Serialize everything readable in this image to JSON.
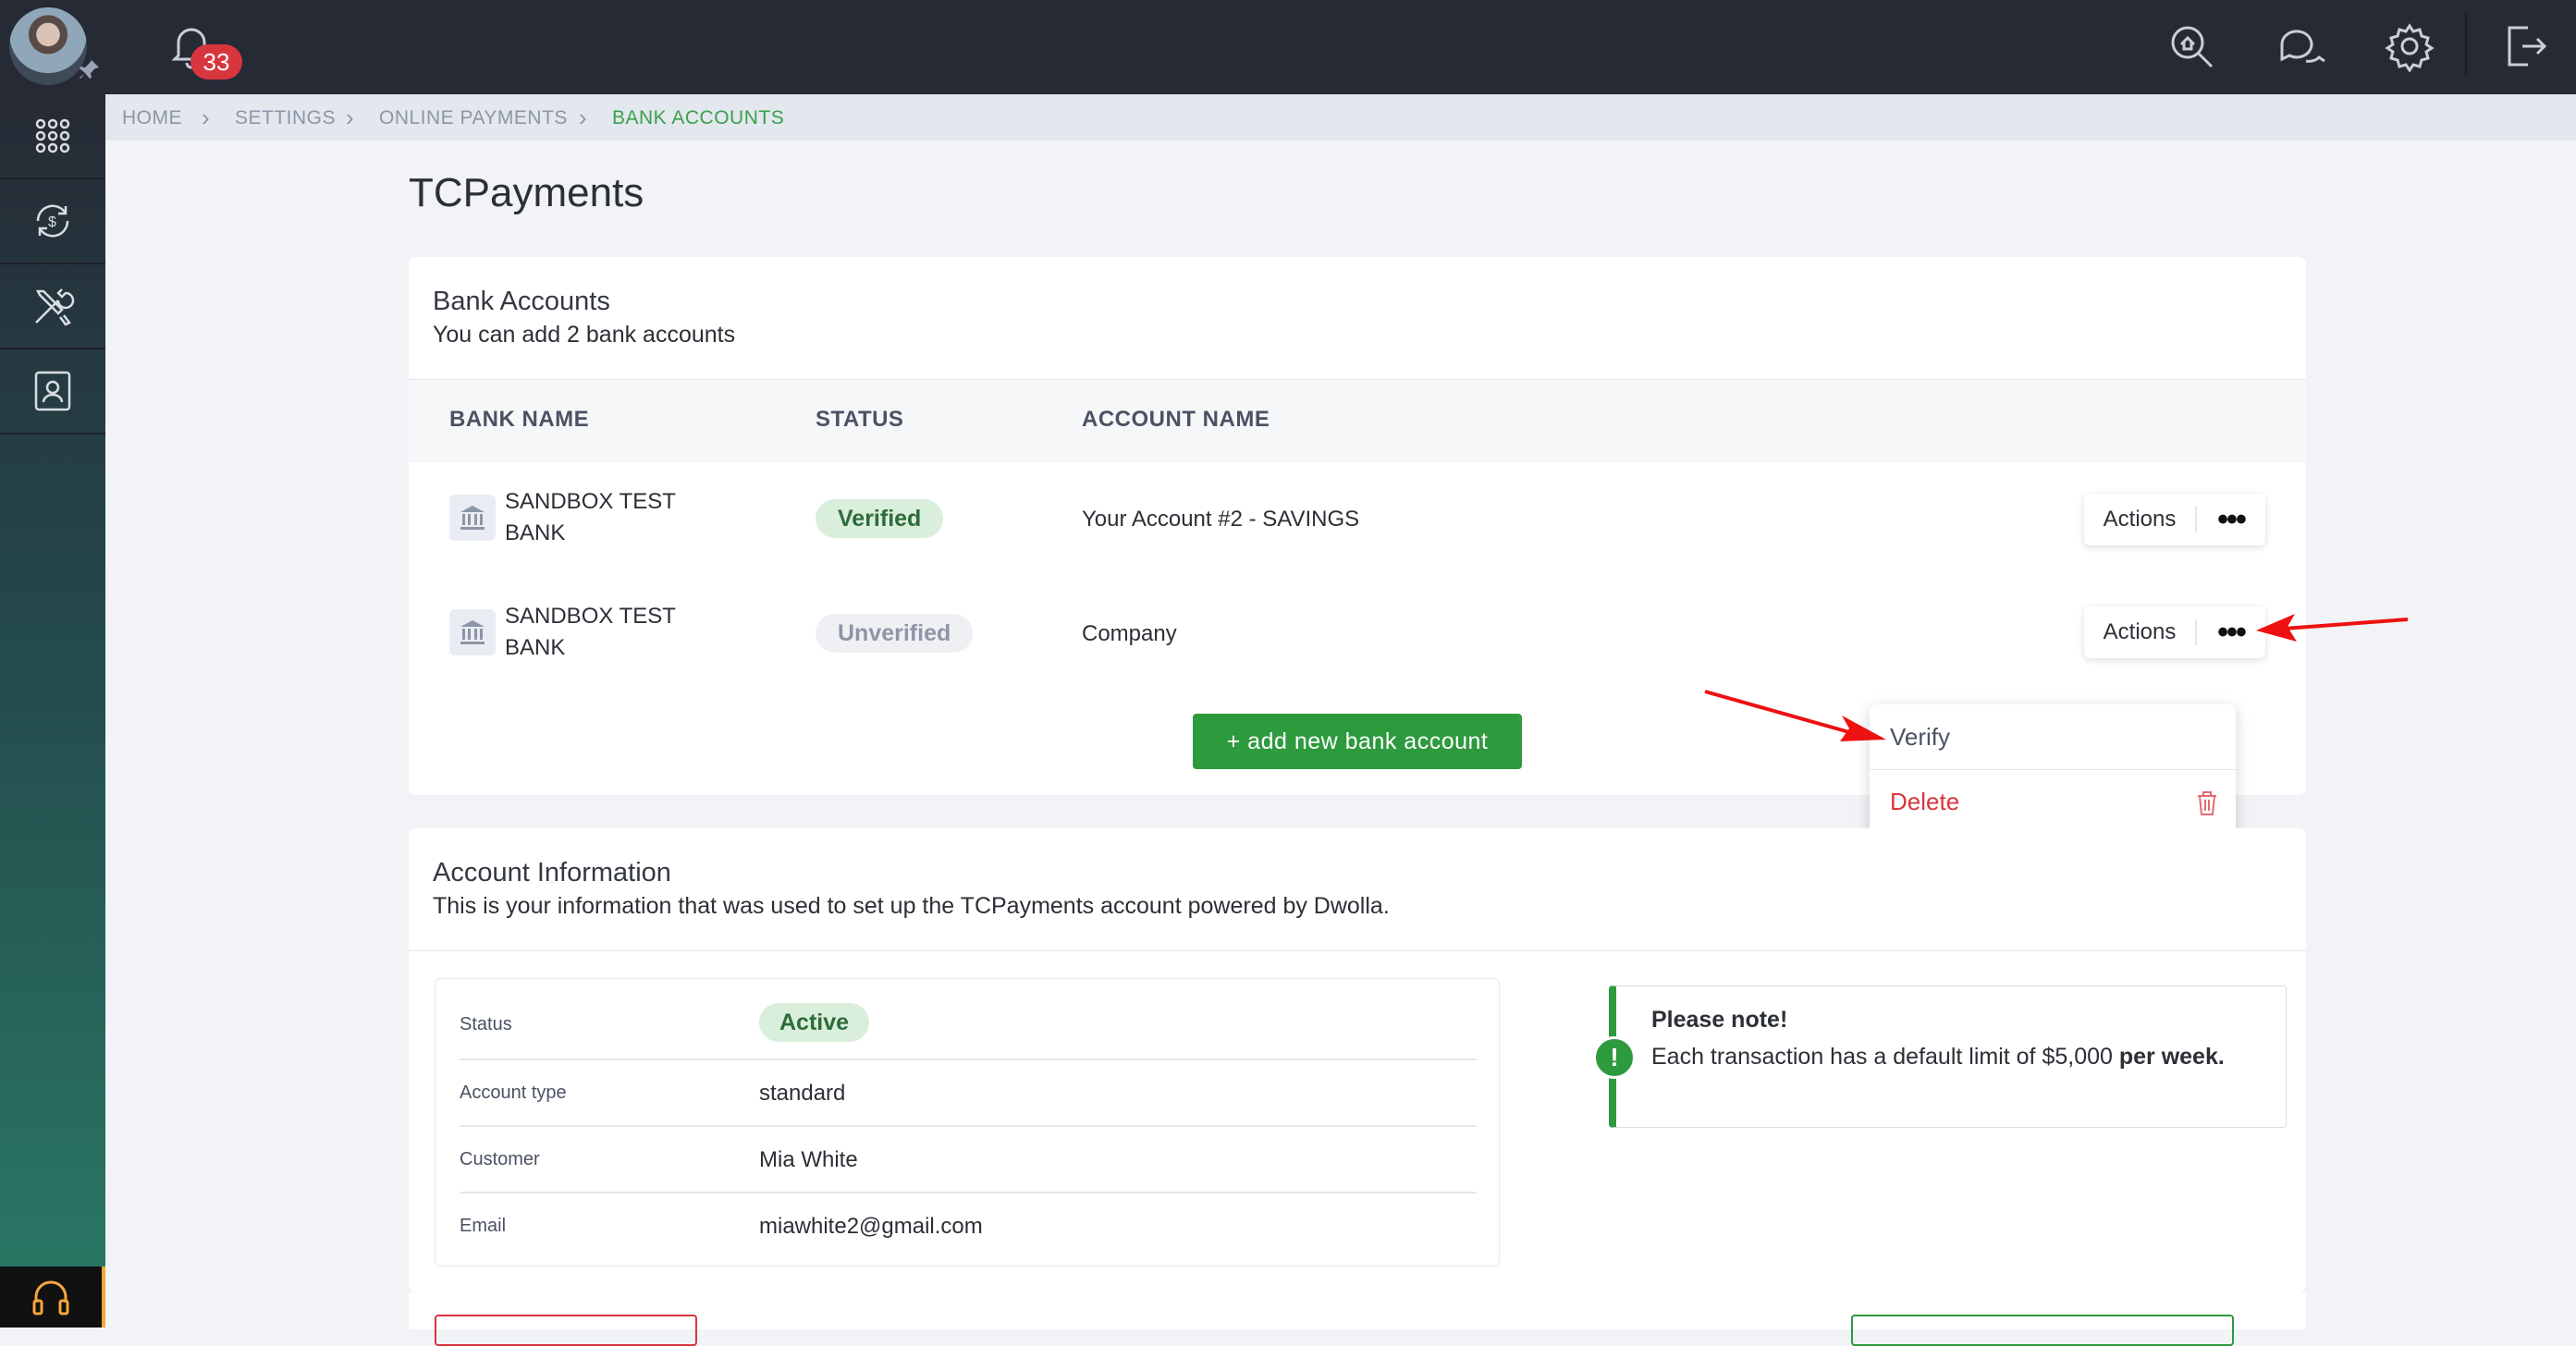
{
  "topbar": {
    "notification_count": "33"
  },
  "breadcrumb": [
    {
      "label": "HOME"
    },
    {
      "label": "SETTINGS"
    },
    {
      "label": "ONLINE PAYMENTS"
    },
    {
      "label": "BANK ACCOUNTS"
    }
  ],
  "page_title": "TCPayments",
  "bank_accounts": {
    "title": "Bank Accounts",
    "subtitle": "You can add 2 bank accounts",
    "columns": [
      "BANK NAME",
      "STATUS",
      "ACCOUNT NAME"
    ],
    "rows": [
      {
        "bank_line1": "SANDBOX TEST",
        "bank_line2": "BANK",
        "status": "Verified",
        "account_name": "Your Account #2 - SAVINGS",
        "actions_label": "Actions"
      },
      {
        "bank_line1": "SANDBOX TEST",
        "bank_line2": "BANK",
        "status": "Unverified",
        "account_name": "Company",
        "actions_label": "Actions"
      }
    ],
    "add_button": "+ add new bank account"
  },
  "actions_menu": {
    "verify": "Verify",
    "delete": "Delete"
  },
  "account_info": {
    "title": "Account Information",
    "subtitle": "This is your information that was used to set up the TCPayments account powered by Dwolla.",
    "fields": [
      {
        "label": "Status",
        "value": "Active"
      },
      {
        "label": "Account type",
        "value": "standard"
      },
      {
        "label": "Customer",
        "value": "Mia White"
      },
      {
        "label": "Email",
        "value": "miawhite2@gmail.com"
      }
    ]
  },
  "note": {
    "title": "Please note!",
    "text_before": "Each transaction has a default limit of $5,000 ",
    "text_bold": "per week."
  },
  "colors": {
    "accent_green": "#2e9a3e",
    "danger_red": "#d8363f",
    "topbar": "#262a35"
  }
}
